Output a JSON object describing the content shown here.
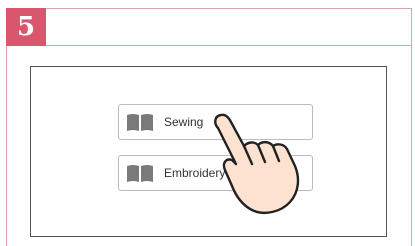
{
  "step": {
    "number": "5",
    "badge_color": "#d9566d"
  },
  "screen": {
    "buttons": [
      {
        "label": "Sewing",
        "icon": "book-icon"
      },
      {
        "label": "Embroidery",
        "icon": "book-icon"
      }
    ]
  },
  "pointer": {
    "icon": "pointing-hand-icon",
    "target": "Sewing"
  }
}
